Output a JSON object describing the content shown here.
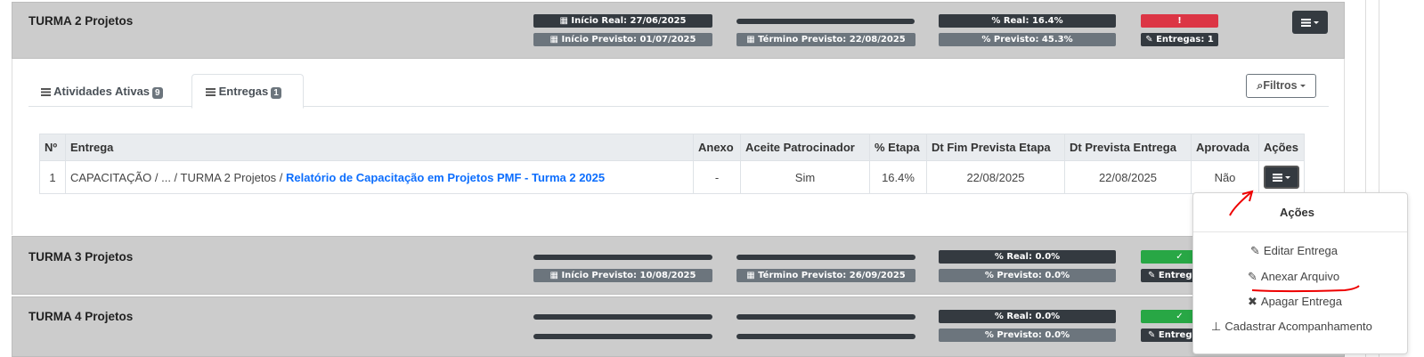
{
  "colors": {
    "dark": "#343a40",
    "gray": "#6c757d",
    "danger": "#dc3545",
    "success": "#28a745",
    "link": "#0d6efd",
    "panel_bg": "#cccccc"
  },
  "icons": {
    "calendar": "calendar-icon",
    "percent": "percent-icon",
    "paperclip": "paperclip-icon",
    "alert": "exclamation-circle-icon",
    "check": "check-circle-icon",
    "list": "list-icon",
    "search": "search-icon",
    "edit": "edit-icon",
    "times": "times-icon",
    "pin": "thumbtack-icon"
  },
  "projects": [
    {
      "title": "TURMA 2 Projetos",
      "inicio_real": "Início Real: 27/06/2025",
      "inicio_previsto": "Início Previsto: 01/07/2025",
      "termino_previsto": "Término Previsto: 22/08/2025",
      "pct_real": "% Real: 16.4%",
      "pct_previsto": "% Previsto: 45.3%",
      "entregas": "Entregas: 1",
      "status_icon": "!"
    },
    {
      "title": "TURMA 3 Projetos",
      "inicio_previsto": "Início Previsto: 10/08/2025",
      "termino_previsto": "Término Previsto: 26/09/2025",
      "pct_real": "% Real: 0.0%",
      "pct_previsto": "% Previsto: 0.0%",
      "entregas": "Entrega",
      "status_icon": "✓"
    },
    {
      "title": "TURMA 4 Projetos",
      "pct_real": "% Real: 0.0%",
      "pct_previsto": "% Previsto: 0.0%",
      "entregas": "Entrega",
      "status_icon": "✓"
    }
  ],
  "tabs": [
    {
      "label": "Atividades Ativas",
      "count": "9"
    },
    {
      "label": "Entregas",
      "count": "1"
    }
  ],
  "filter_label": "Filtros",
  "table": {
    "headers": [
      "Nº",
      "Entrega",
      "Anexo",
      "Aceite Patrocinador",
      "% Etapa",
      "Dt Fim Prevista Etapa",
      "Dt Prevista Entrega",
      "Aprovada",
      "Ações"
    ],
    "rows": [
      {
        "num": "1",
        "path": "CAPACITAÇÃO / ... / TURMA 2 Projetos / ",
        "link": "Relatório de Capacitação em Projetos PMF - Turma 2 2025",
        "anexo": "-",
        "aceite": "Sim",
        "etapa": "16.4%",
        "dt_fim": "22/08/2025",
        "dt_entrega": "22/08/2025",
        "aprovada": "Não"
      }
    ]
  },
  "dropdown": {
    "header": "Ações",
    "items": [
      "Editar Entrega",
      "Anexar Arquivo",
      "Apagar Entrega",
      "Cadastrar Acompanhamento"
    ]
  }
}
